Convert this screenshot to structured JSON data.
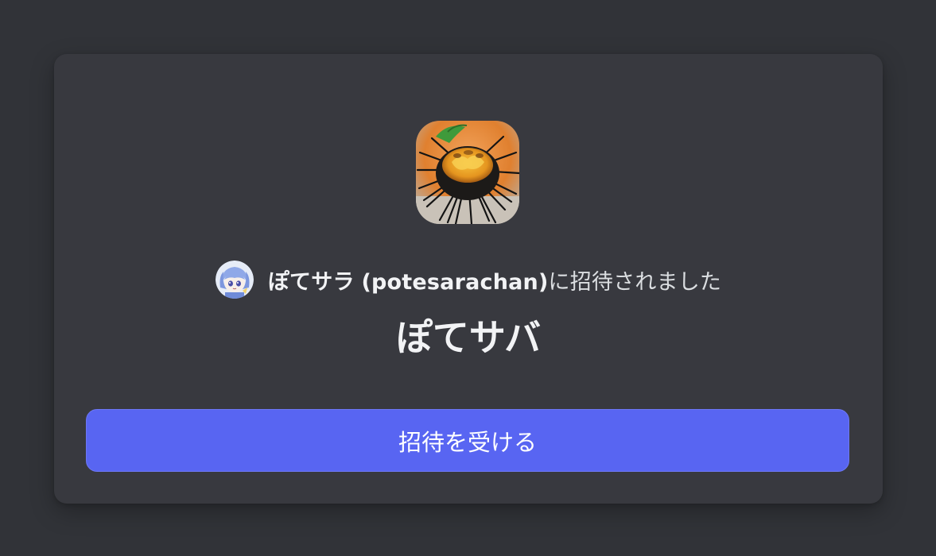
{
  "invite": {
    "inviter_display_name": "ぽてサラ",
    "inviter_username": "(potesarachan)",
    "invited_suffix": "に招待されました",
    "server_name": "ぽてサバ",
    "accept_button_label": "招待を受ける"
  },
  "colors": {
    "background": "#313338",
    "card": "#38393f",
    "accent": "#5865f2"
  }
}
